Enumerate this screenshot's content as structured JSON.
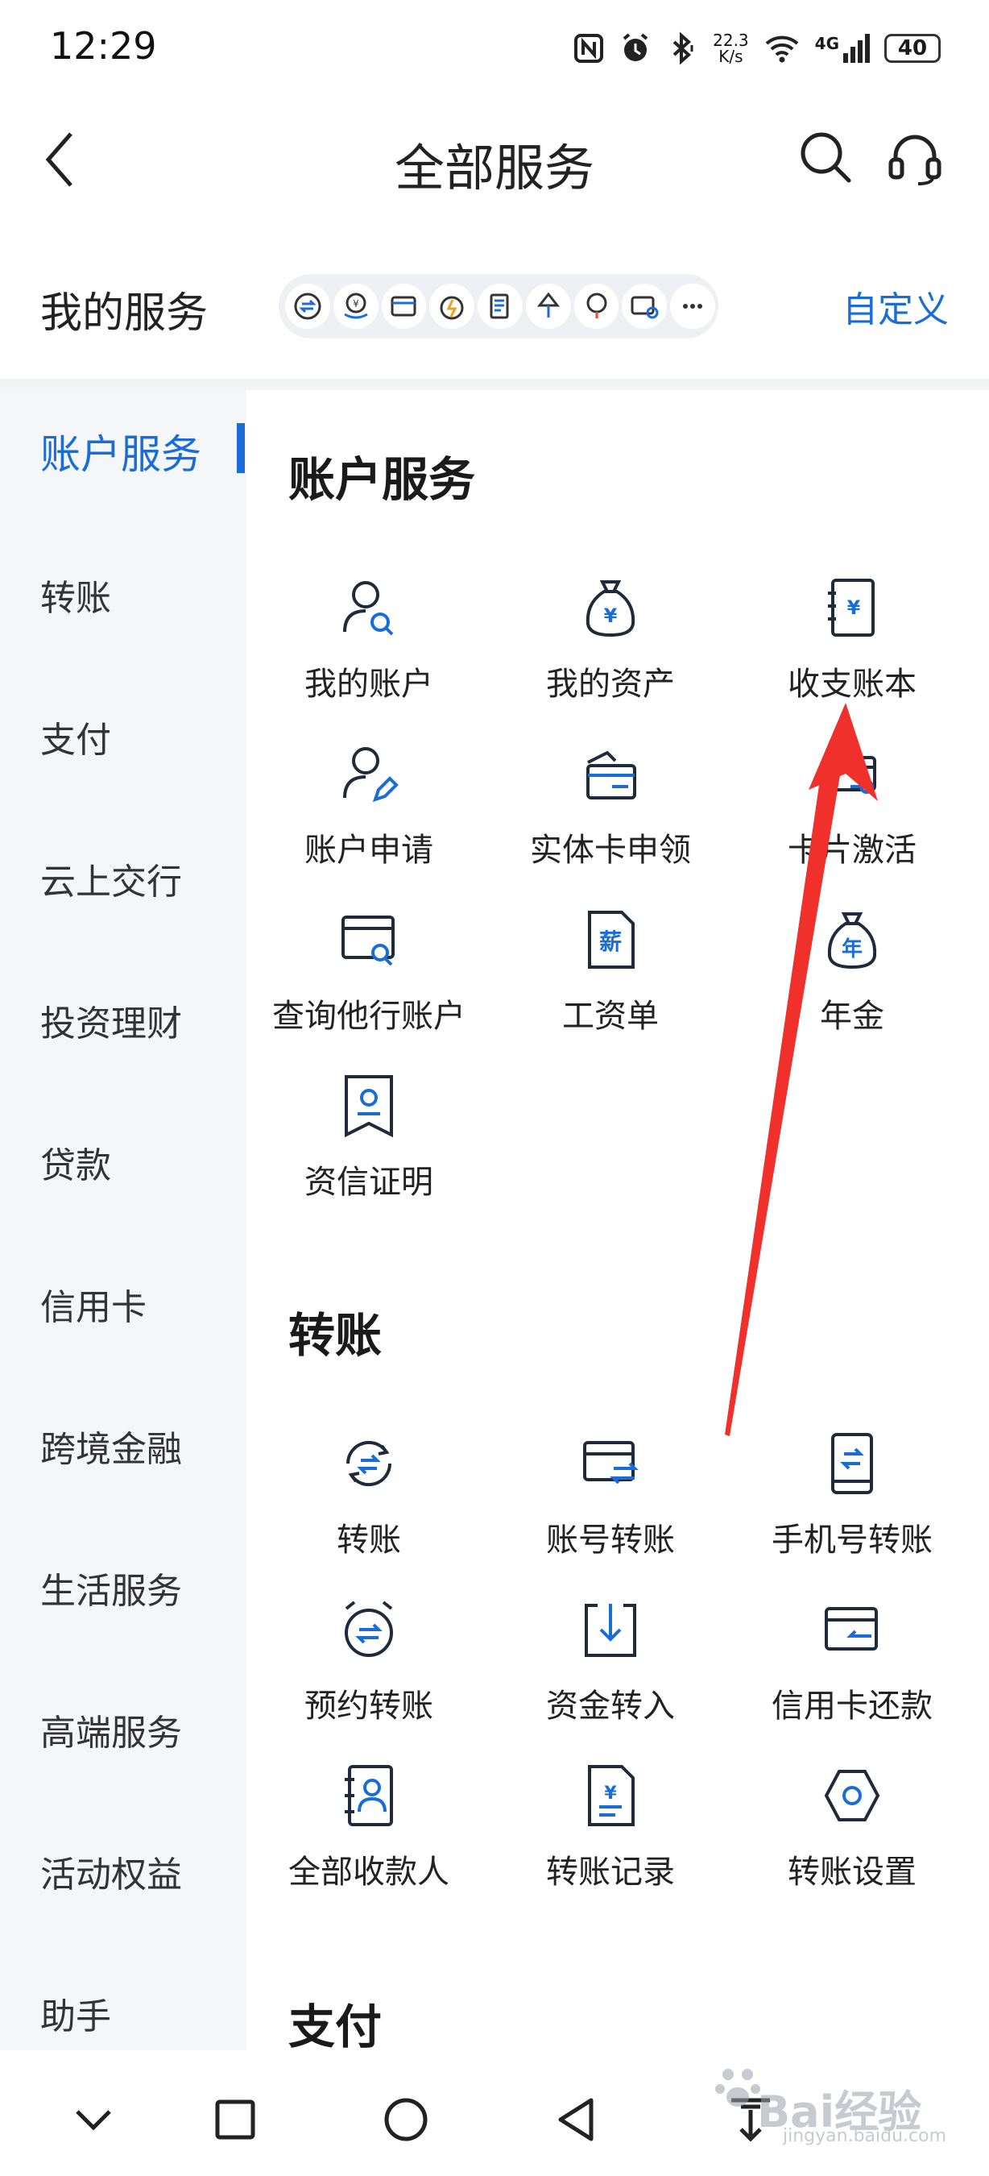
{
  "status_bar": {
    "time": "12:29",
    "net_speed_value": "22.3",
    "net_speed_unit": "K/s",
    "network": "4G",
    "battery": "40"
  },
  "header": {
    "title": "全部服务"
  },
  "my_services": {
    "label": "我的服务",
    "customize": "自定义"
  },
  "sidebar": {
    "items": [
      "账户服务",
      "转账",
      "支付",
      "云上交行",
      "投资理财",
      "贷款",
      "信用卡",
      "跨境金融",
      "生活服务",
      "高端服务",
      "活动权益",
      "助手"
    ],
    "active_index": 0
  },
  "sections": [
    {
      "title": "账户服务",
      "tiles": [
        "我的账户",
        "我的资产",
        "收支账本",
        "账户申请",
        "实体卡申领",
        "卡片激活",
        "查询他行账户",
        "工资单",
        "年金",
        "资信证明"
      ]
    },
    {
      "title": "转账",
      "tiles": [
        "转账",
        "账号转账",
        "手机号转账",
        "预约转账",
        "资金转入",
        "信用卡还款",
        "全部收款人",
        "转账记录",
        "转账设置"
      ]
    },
    {
      "title": "支付"
    }
  ],
  "watermark": {
    "brand": "Bai经验",
    "url": "jingyan.baidu.com"
  },
  "colors": {
    "accent": "#1a6dd8",
    "icon_dark": "#1f2a3a",
    "annotation_arrow": "#f0302a"
  }
}
